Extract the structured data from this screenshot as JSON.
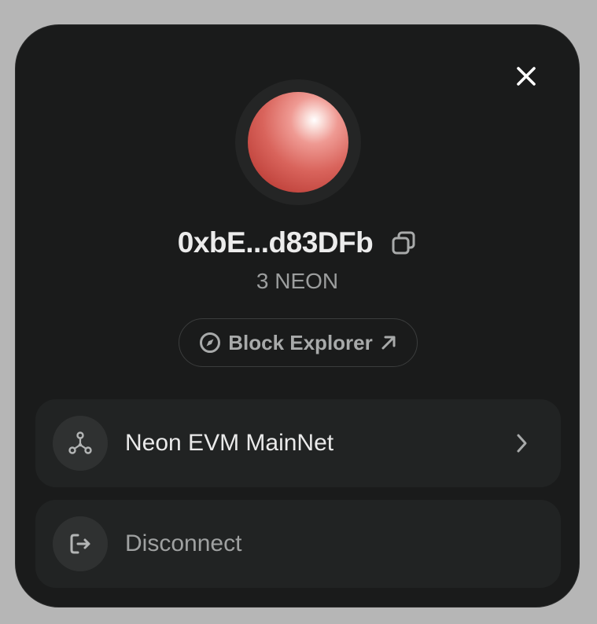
{
  "wallet": {
    "address": "0xbE...d83DFb",
    "balance": "3 NEON",
    "explorer_label": "Block Explorer"
  },
  "network": {
    "label": "Neon EVM MainNet"
  },
  "actions": {
    "disconnect_label": "Disconnect"
  },
  "icons": {
    "close": "close-icon",
    "copy": "copy-icon",
    "compass": "compass-icon",
    "external": "arrow-up-right-icon",
    "network": "network-nodes-icon",
    "chevron": "chevron-right-icon",
    "disconnect": "logout-icon"
  },
  "colors": {
    "modal_bg": "#1a1b1b",
    "row_bg": "#212323",
    "avatar": "#d9645c",
    "text_primary": "#ececec",
    "text_muted": "#9c9e9e"
  }
}
